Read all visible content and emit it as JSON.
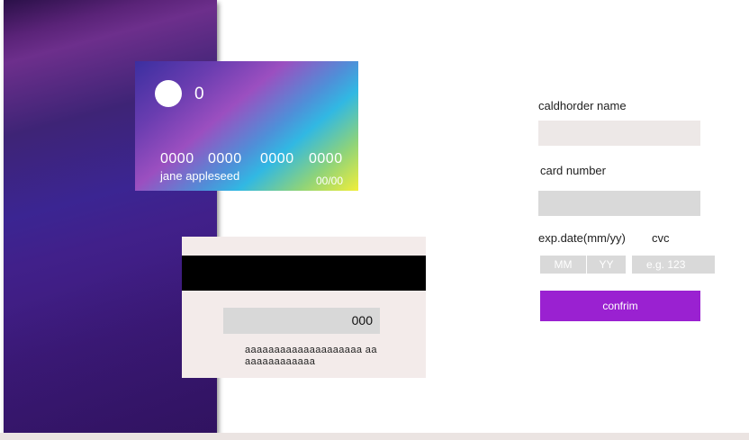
{
  "card_front": {
    "logo_text": "0",
    "number_groups": [
      "0000",
      "0000",
      "0000",
      "0000"
    ],
    "holder_name": "jane appleseed",
    "expiry": "00/00"
  },
  "card_back": {
    "cvc": "000",
    "fine_print": "aaaaaaaaaaaaaaaaaaaa aaaaaaaaaaaaaa"
  },
  "form": {
    "name_label": "caldhorder name",
    "number_label": "card number",
    "exp_label": "exp.date(mm/yy)",
    "cvc_label": "cvc",
    "mm_placeholder": "MM",
    "yy_placeholder": "YY",
    "cvc_placeholder": "e.g. 123",
    "confirm_label": "confrim"
  },
  "colors": {
    "accent": "#9a21d1",
    "panel": "#3b1a78",
    "field": "#d9d9d9"
  }
}
